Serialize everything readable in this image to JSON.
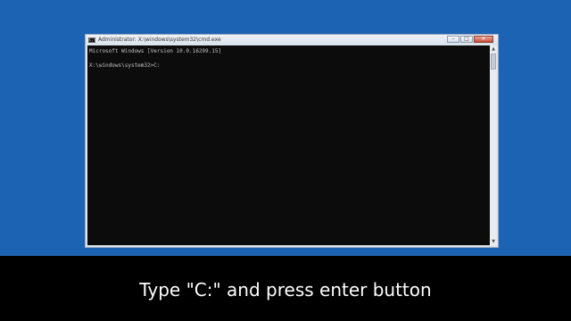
{
  "window": {
    "title": "Administrator: X:\\windows\\system32\\cmd.exe",
    "icon": "cmd-icon",
    "icon_text": "C:\\",
    "controls": {
      "minimize": "–",
      "maximize": "□",
      "close": "✕"
    }
  },
  "console": {
    "text": "Microsoft Windows [Version 10.0.16299.15]\n\nX:\\windows\\system32>C:"
  },
  "scrollbar": {
    "up": "▲",
    "down": "▼"
  },
  "caption": {
    "text": "Type \"C:\" and press enter button"
  },
  "colors": {
    "desktop": "#1d63b4",
    "console_bg": "#0c0c0c",
    "console_text": "#c6c6c6",
    "caption_bg": "#000000",
    "caption_text": "#ffffff"
  }
}
